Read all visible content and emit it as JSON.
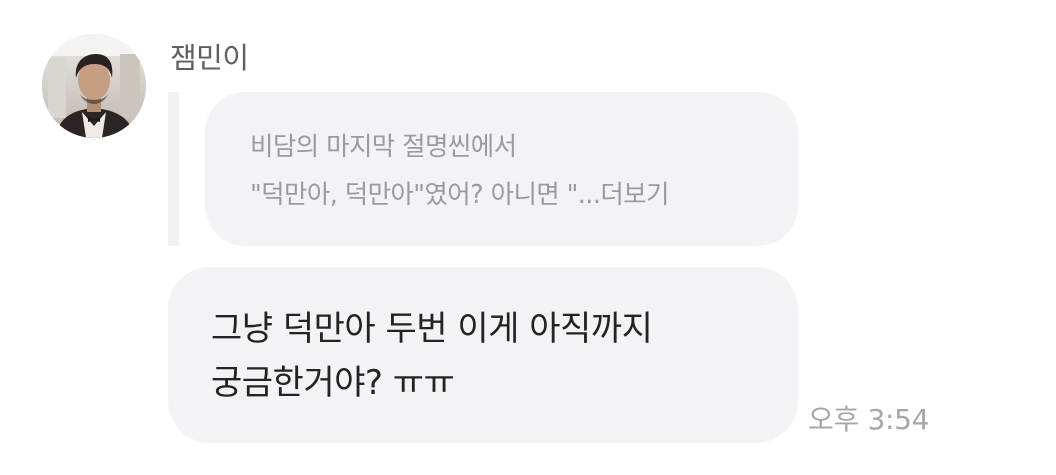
{
  "sender": {
    "name": "잼민이",
    "avatar_icon": "profile-photo"
  },
  "quoted_message": {
    "lines": [
      "비담의 마지막 절명씬에서",
      "\"덕만아, 덕만아\"였어? 아니면 \"..."
    ],
    "more_label": "더보기"
  },
  "message": {
    "lines": [
      "그냥 덕만아 두번 이게 아직까지",
      "궁금한거야? ㅠㅠ"
    ]
  },
  "timestamp": "오후 3:54",
  "colors": {
    "bubble_bg": "#f3f3f6",
    "text": "#232323",
    "muted_text": "#9a9aa0",
    "timestamp": "#a7a7ab"
  }
}
